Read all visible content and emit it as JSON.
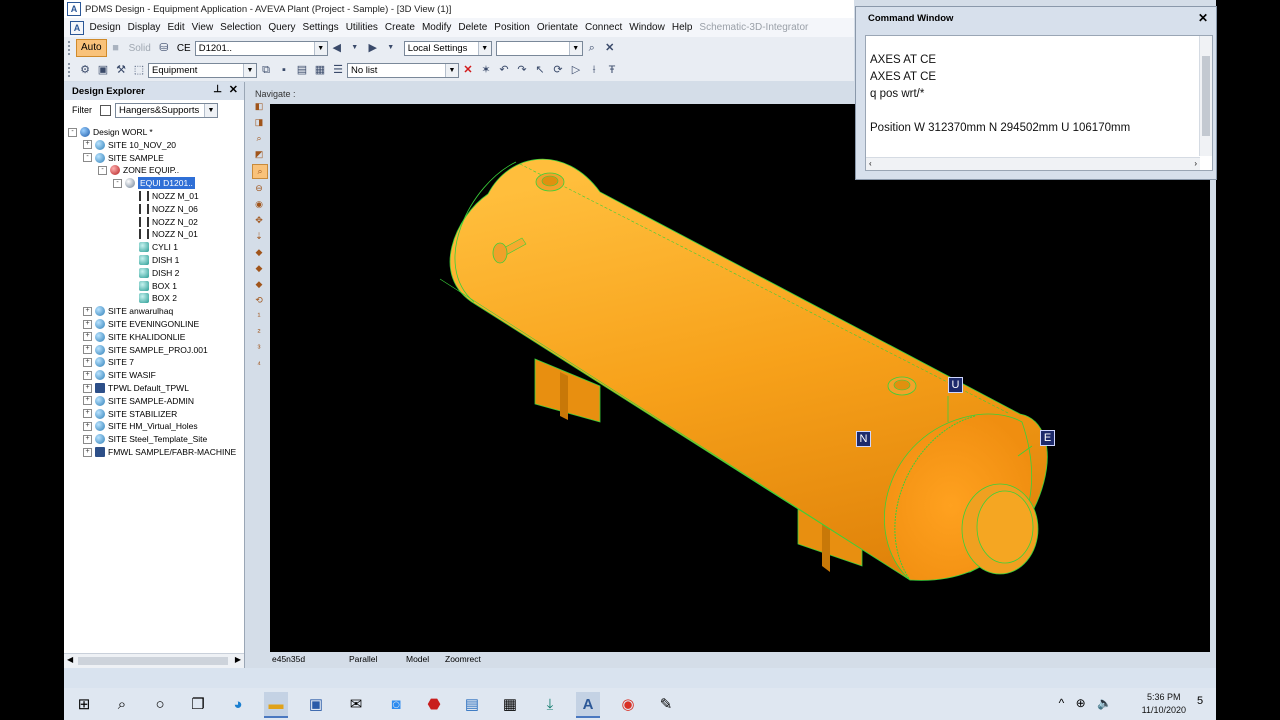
{
  "window": {
    "title": "PDMS Design - Equipment Application - AVEVA Plant (Project - Sample) - [3D View (1)]",
    "logo_letter": "A"
  },
  "menu": {
    "items": [
      "Design",
      "Display",
      "Edit",
      "View",
      "Selection",
      "Query",
      "Settings",
      "Utilities",
      "Create",
      "Modify",
      "Delete",
      "Position",
      "Orientate",
      "Connect",
      "Window",
      "Help"
    ],
    "disabled_item": "Schematic-3D-Integrator"
  },
  "toolbar1": {
    "auto_label": "Auto",
    "solid_label": "Solid",
    "ce_label": "CE",
    "ce_value": "D1201..",
    "settings_value": "Local Settings",
    "extra_value": ""
  },
  "toolbar2": {
    "discipline_value": "Equipment",
    "list_value": "No list"
  },
  "explorer": {
    "title": "Design Explorer",
    "filter_label": "Filter",
    "filter_value": "Hangers&Supports",
    "tree": [
      {
        "label": "Design WORL *",
        "type": "world",
        "depth": 0,
        "exp": "-"
      },
      {
        "label": "SITE 10_NOV_20",
        "type": "site",
        "depth": 1,
        "exp": "+"
      },
      {
        "label": "SITE SAMPLE",
        "type": "site",
        "depth": 1,
        "exp": "-"
      },
      {
        "label": "ZONE EQUIP..",
        "type": "zone",
        "depth": 2,
        "exp": "-"
      },
      {
        "label": "EQUI D1201..",
        "type": "equi",
        "depth": 3,
        "exp": "-",
        "selected": true
      },
      {
        "label": "NOZZ M_01",
        "type": "nozz",
        "depth": 4,
        "exp": ""
      },
      {
        "label": "NOZZ N_06",
        "type": "nozz",
        "depth": 4,
        "exp": ""
      },
      {
        "label": "NOZZ N_02",
        "type": "nozz",
        "depth": 4,
        "exp": ""
      },
      {
        "label": "NOZZ N_01",
        "type": "nozz",
        "depth": 4,
        "exp": ""
      },
      {
        "label": "CYLI 1",
        "type": "prim",
        "depth": 4,
        "exp": ""
      },
      {
        "label": "DISH 1",
        "type": "prim",
        "depth": 4,
        "exp": ""
      },
      {
        "label": "DISH 2",
        "type": "prim",
        "depth": 4,
        "exp": ""
      },
      {
        "label": "BOX 1",
        "type": "prim",
        "depth": 4,
        "exp": ""
      },
      {
        "label": "BOX 2",
        "type": "prim",
        "depth": 4,
        "exp": ""
      },
      {
        "label": "SITE anwarulhaq",
        "type": "site",
        "depth": 1,
        "exp": "+"
      },
      {
        "label": "SITE EVENINGONLINE",
        "type": "site",
        "depth": 1,
        "exp": "+"
      },
      {
        "label": "SITE KHALIDONLIE",
        "type": "site",
        "depth": 1,
        "exp": "+"
      },
      {
        "label": "SITE SAMPLE_PROJ.001",
        "type": "site",
        "depth": 1,
        "exp": "+"
      },
      {
        "label": "SITE 7",
        "type": "site",
        "depth": 1,
        "exp": "+"
      },
      {
        "label": "SITE WASIF",
        "type": "site",
        "depth": 1,
        "exp": "+"
      },
      {
        "label": "TPWL Default_TPWL",
        "type": "tpwl",
        "depth": 1,
        "exp": "+"
      },
      {
        "label": "SITE SAMPLE-ADMIN",
        "type": "site",
        "depth": 1,
        "exp": "+"
      },
      {
        "label": "SITE STABILIZER",
        "type": "site",
        "depth": 1,
        "exp": "+"
      },
      {
        "label": "SITE HM_Virtual_Holes",
        "type": "site",
        "depth": 1,
        "exp": "+"
      },
      {
        "label": "SITE Steel_Template_Site",
        "type": "site",
        "depth": 1,
        "exp": "+"
      },
      {
        "label": "FMWL SAMPLE/FABR-MACHINE",
        "type": "tpwl",
        "depth": 1,
        "exp": "+"
      }
    ]
  },
  "view": {
    "navigate_label": "Navigate :",
    "axis_labels": {
      "u": "U",
      "n": "N",
      "e": "E"
    },
    "status": {
      "direction": "e45n35d",
      "projection": "Parallel",
      "mode": "Model",
      "zoom": "Zoomrect"
    },
    "colors": {
      "vessel": "#f7a11a",
      "edge": "#3ad13a",
      "background": "#000000"
    }
  },
  "command_window": {
    "title": "Command Window",
    "lines": [
      "AXES AT CE",
      "AXES AT CE",
      "q pos wrt/*",
      "",
      "Position W 312370mm N 294502mm U 106170mm"
    ]
  },
  "taskbar": {
    "time": "5:36 PM",
    "date": "11/10/2020",
    "notification_count": "5"
  }
}
